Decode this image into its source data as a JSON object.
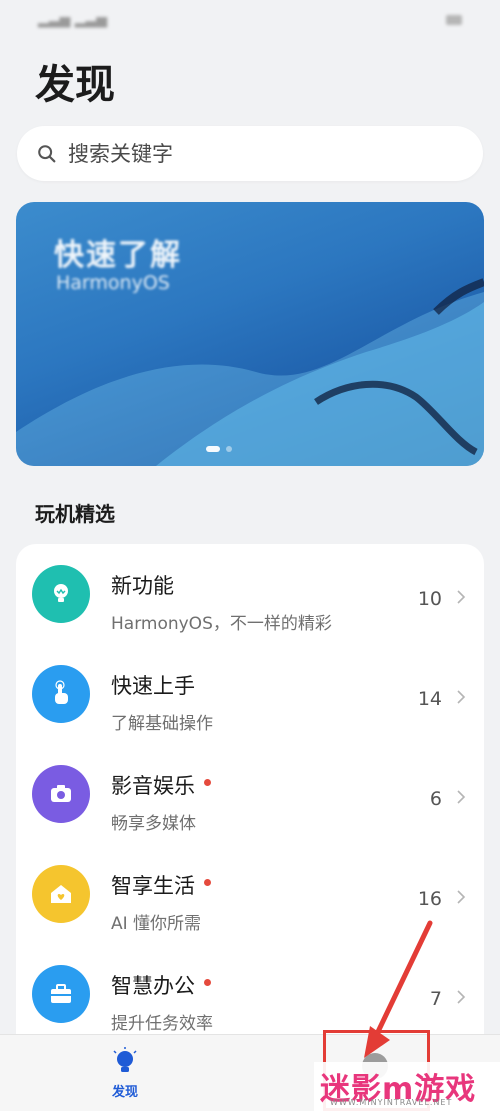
{
  "header": {
    "title": "发现"
  },
  "search": {
    "placeholder": "搜索关键字"
  },
  "banner": {
    "title": "快速了解",
    "subtitle": "HarmonyOS"
  },
  "section": {
    "title": "玩机精选"
  },
  "list": [
    {
      "title": "新功能",
      "subtitle": "HarmonyOS，不一样的精彩",
      "count": "10",
      "has_dot": false,
      "icon": "lightbulb-icon",
      "color": "#1fbfb0"
    },
    {
      "title": "快速上手",
      "subtitle": "了解基础操作",
      "count": "14",
      "has_dot": false,
      "icon": "tap-hand-icon",
      "color": "#2a9df0"
    },
    {
      "title": "影音娱乐",
      "subtitle": "畅享多媒体",
      "count": "6",
      "has_dot": true,
      "icon": "camera-icon",
      "color": "#7a5ce2"
    },
    {
      "title": "智享生活",
      "subtitle": "AI 懂你所需",
      "count": "16",
      "has_dot": true,
      "icon": "home-heart-icon",
      "color": "#f5c52e"
    },
    {
      "title": "智慧办公",
      "subtitle": "提升任务效率",
      "count": "7",
      "has_dot": true,
      "icon": "briefcase-icon",
      "color": "#2a9df0"
    }
  ],
  "nav": {
    "discover_label": "发现"
  },
  "watermark": {
    "text": "迷影m游戏",
    "sub": "WWW.MINYINTRAVEL.NET"
  },
  "colors": {
    "accent": "#1f5bd6",
    "annotation": "#e33c36",
    "badge": "#e54a3d"
  }
}
